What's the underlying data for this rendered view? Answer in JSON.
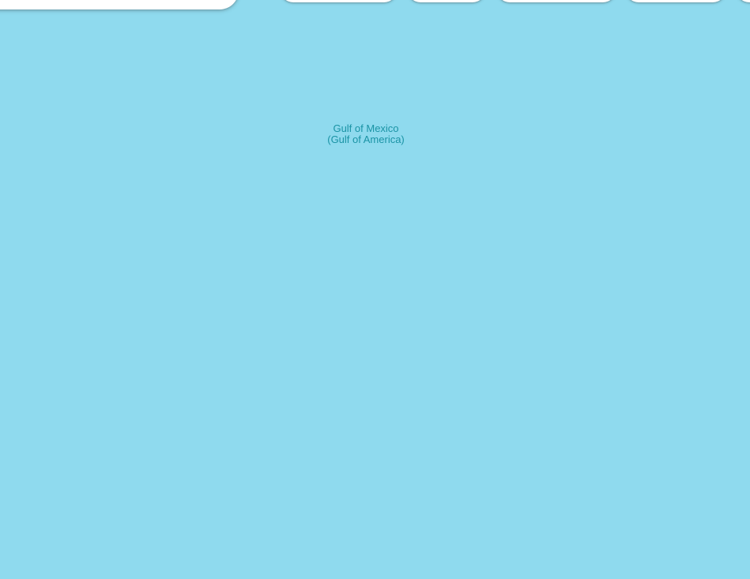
{
  "map": {
    "water_color": "#8fdaee",
    "label_color": "#1a93a5",
    "water_label": "Gulf of Mexico (Gulf of America)"
  },
  "overlay": {
    "search_panel_present": true,
    "chip_count": 5
  }
}
